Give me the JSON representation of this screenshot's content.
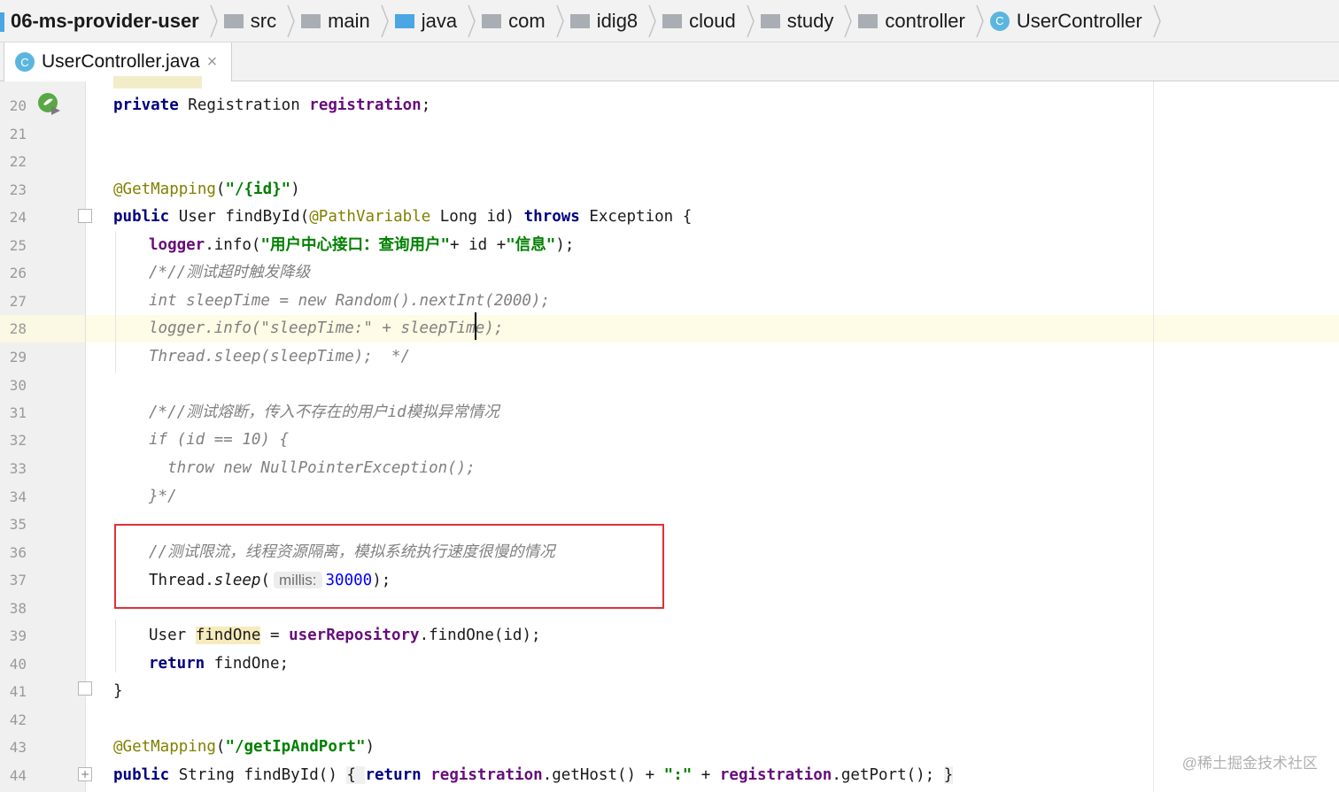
{
  "breadcrumb": {
    "items": [
      {
        "label": "06-ms-provider-user",
        "icon": "module-icon"
      },
      {
        "label": "src",
        "icon": "folder-icon"
      },
      {
        "label": "main",
        "icon": "folder-icon"
      },
      {
        "label": "java",
        "icon": "source-folder-icon"
      },
      {
        "label": "com",
        "icon": "package-icon"
      },
      {
        "label": "idig8",
        "icon": "package-icon"
      },
      {
        "label": "cloud",
        "icon": "package-icon"
      },
      {
        "label": "study",
        "icon": "package-icon"
      },
      {
        "label": "controller",
        "icon": "package-icon"
      },
      {
        "label": "UserController",
        "icon": "class-icon"
      }
    ]
  },
  "tab": {
    "label": "UserController.java",
    "icon_letter": "C",
    "close": "×"
  },
  "editor": {
    "lines": [
      {
        "n": "20"
      },
      {
        "n": "21"
      },
      {
        "n": "22"
      },
      {
        "n": "23"
      },
      {
        "n": "24"
      },
      {
        "n": "25"
      },
      {
        "n": "26"
      },
      {
        "n": "27"
      },
      {
        "n": "28"
      },
      {
        "n": "29"
      },
      {
        "n": "30"
      },
      {
        "n": "31"
      },
      {
        "n": "32"
      },
      {
        "n": "33"
      },
      {
        "n": "34"
      },
      {
        "n": "35"
      },
      {
        "n": "36"
      },
      {
        "n": "37"
      },
      {
        "n": "38"
      },
      {
        "n": "39"
      },
      {
        "n": "40"
      },
      {
        "n": "41"
      },
      {
        "n": "42"
      },
      {
        "n": "43"
      },
      {
        "n": "44"
      }
    ],
    "l20": {
      "kw": "private",
      "type": " Registration ",
      "field": "registration",
      "end": ";"
    },
    "l23": {
      "ann": "@GetMapping",
      "open": "(",
      "str": "\"/{id}\"",
      "close": ")"
    },
    "l24": {
      "kw1": "public",
      "mid1": " User findById(",
      "ann": "@PathVariable",
      "mid2": " Long id) ",
      "kw2": "throws",
      "end": " Exception {"
    },
    "l25": {
      "field": "logger",
      "mid": ".info(",
      "str1": "\"用户中心接口：查询用户\"",
      "mid2": "+ id +",
      "str2": "\"信息\"",
      "end": ");"
    },
    "l26": {
      "text": "/*//测试超时触发降级"
    },
    "l27": {
      "text": "int sleepTime = new Random().nextInt(2000);"
    },
    "l28": {
      "text": "logger.info(\"sleepTime:\" + sleepTime);"
    },
    "l29": {
      "text": "Thread.sleep(sleepTime);  */"
    },
    "l31": {
      "text": "/*//测试熔断，传入不存在的用户id模拟异常情况"
    },
    "l32": {
      "text": "if (id == 10) {"
    },
    "l33": {
      "text": "  throw new NullPointerException();"
    },
    "l34": {
      "text": "}*/"
    },
    "l36": {
      "text": "//测试限流，线程资源隔离，模拟系统执行速度很慢的情况"
    },
    "l37": {
      "cls": "Thread.",
      "method": "sleep",
      "open": "(",
      "hint": "millis:",
      "num": "30000",
      "end": ");"
    },
    "l39": {
      "type": "User ",
      "var": "findOne",
      "mid": " = ",
      "field": "userRepository",
      "end": ".findOne(id);"
    },
    "l40": {
      "kw": "return",
      "end": " findOne;"
    },
    "l41": {
      "text": "}"
    },
    "l43": {
      "ann": "@GetMapping",
      "open": "(",
      "str": "\"/getIpAndPort\"",
      "close": ")"
    },
    "l44": {
      "kw1": "public",
      "mid1": " String findById() ",
      "brace1": "{ ",
      "kw2": "return",
      "sp": " ",
      "field1": "registration",
      "mid2": ".getHost() + ",
      "str": "\":\"",
      "mid3": " + ",
      "field2": "registration",
      "mid4": ".getPort(); ",
      "brace2": "}"
    }
  },
  "watermark": "@稀土掘金技术社区",
  "colors": {
    "keyword": "#000080",
    "field": "#660e7a",
    "annotation": "#808000",
    "string": "#008000",
    "number": "#0000ff",
    "comment": "#808080",
    "highlight_box": "#e0303a"
  }
}
